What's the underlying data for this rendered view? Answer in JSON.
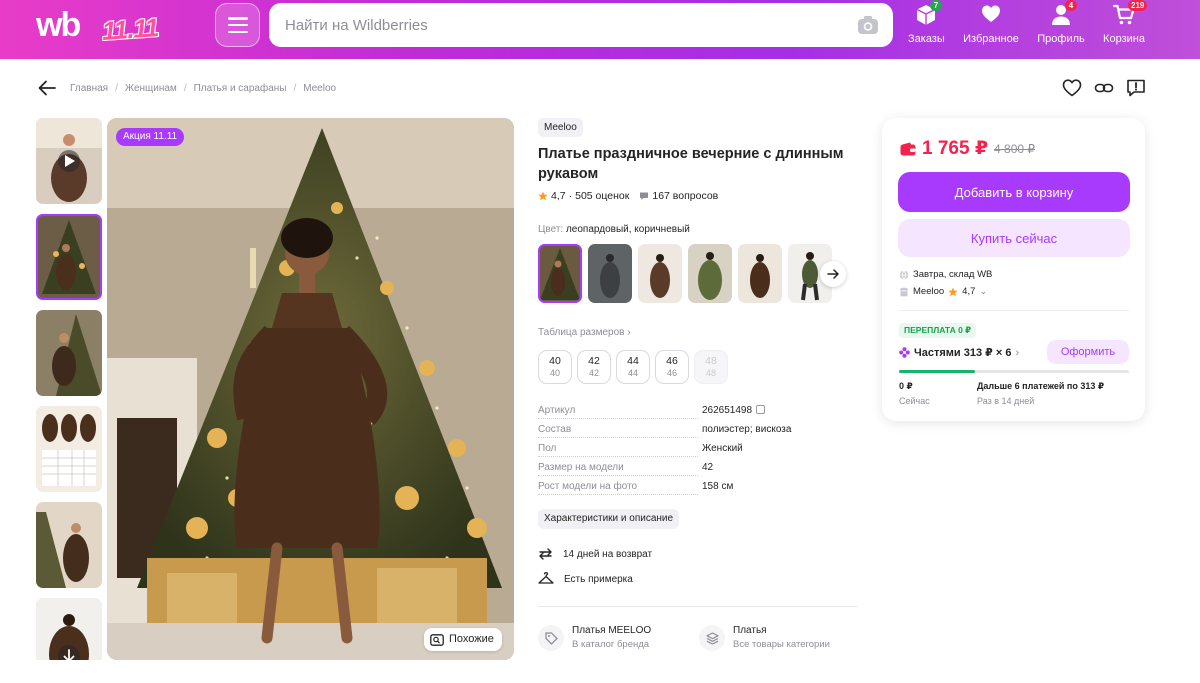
{
  "colors": {
    "accent": "#a73afd",
    "price": "#f5234c",
    "header_from": "#e83cc8",
    "header_to": "#a52ee6",
    "success": "#16a34a"
  },
  "header": {
    "logo_text": "wb",
    "promo_text": "11.11",
    "search_placeholder": "Найти на Wildberries",
    "nav": [
      {
        "label": "Заказы",
        "icon": "box-icon",
        "badge": "7",
        "badge_color": "#22a94f"
      },
      {
        "label": "Избранное",
        "icon": "heart-icon",
        "badge": "",
        "badge_color": ""
      },
      {
        "label": "Профиль",
        "icon": "user-icon",
        "badge": "4",
        "badge_color": "#f5234c"
      },
      {
        "label": "Корзина",
        "icon": "cart-icon",
        "badge": "219",
        "badge_color": "#f5234c"
      }
    ]
  },
  "breadcrumbs": [
    "Главная",
    "Женщинам",
    "Платья и сарафаны",
    "Meeloo"
  ],
  "gallery": {
    "promo_badge": "Акция 11.11",
    "similar_label": "Похожие",
    "thumbs": [
      "video",
      "photo",
      "photo",
      "size-chart",
      "photo",
      "photo"
    ]
  },
  "product": {
    "brand": "Meeloo",
    "title": "Платье праздничное вечерние с длинным рукавом",
    "rating": "4,7",
    "reviews": "505 оценок",
    "questions": "167 вопросов",
    "color_label": "Цвет:",
    "color_value": "леопардовый, коричневый",
    "size_table_label": "Таблица размеров",
    "sizes": [
      {
        "size": "40",
        "ru": "40",
        "available": true
      },
      {
        "size": "42",
        "ru": "42",
        "available": true
      },
      {
        "size": "44",
        "ru": "44",
        "available": true
      },
      {
        "size": "46",
        "ru": "46",
        "available": true
      },
      {
        "size": "48",
        "ru": "48",
        "available": false
      }
    ],
    "specs": [
      {
        "key": "Артикул",
        "value": "262651498"
      },
      {
        "key": "Состав",
        "value": "полиэстер; вискоза"
      },
      {
        "key": "Пол",
        "value": "Женский"
      },
      {
        "key": "Размер на модели",
        "value": "42"
      },
      {
        "key": "Рост модели на фото",
        "value": "158 см"
      }
    ],
    "chars_button": "Характеристики и описание",
    "features": [
      "14 дней на возврат",
      "Есть примерка"
    ],
    "brand_link": {
      "title": "Платья MEELOO",
      "sub": "В каталог бренда"
    },
    "category_link": {
      "title": "Платья",
      "sub": "Все товары категории"
    }
  },
  "buy": {
    "price": "1 765 ₽",
    "old_price": "4 800 ₽",
    "add_to_cart": "Добавить в корзину",
    "buy_now": "Купить сейчас",
    "delivery": "Завтра, склад WB",
    "seller": "Meeloo",
    "seller_rating": "4,7",
    "overpay_badge": "ПЕРЕПЛАТА 0 ₽",
    "installments": "Частями 313 ₽ × 6",
    "pay_button": "Оформить",
    "installment_progress": 0.33,
    "now_amount": "0 ₽",
    "now_label": "Сейчас",
    "later_amount": "Дальше 6 платежей по 313 ₽",
    "later_label": "Раз в 14 дней"
  }
}
